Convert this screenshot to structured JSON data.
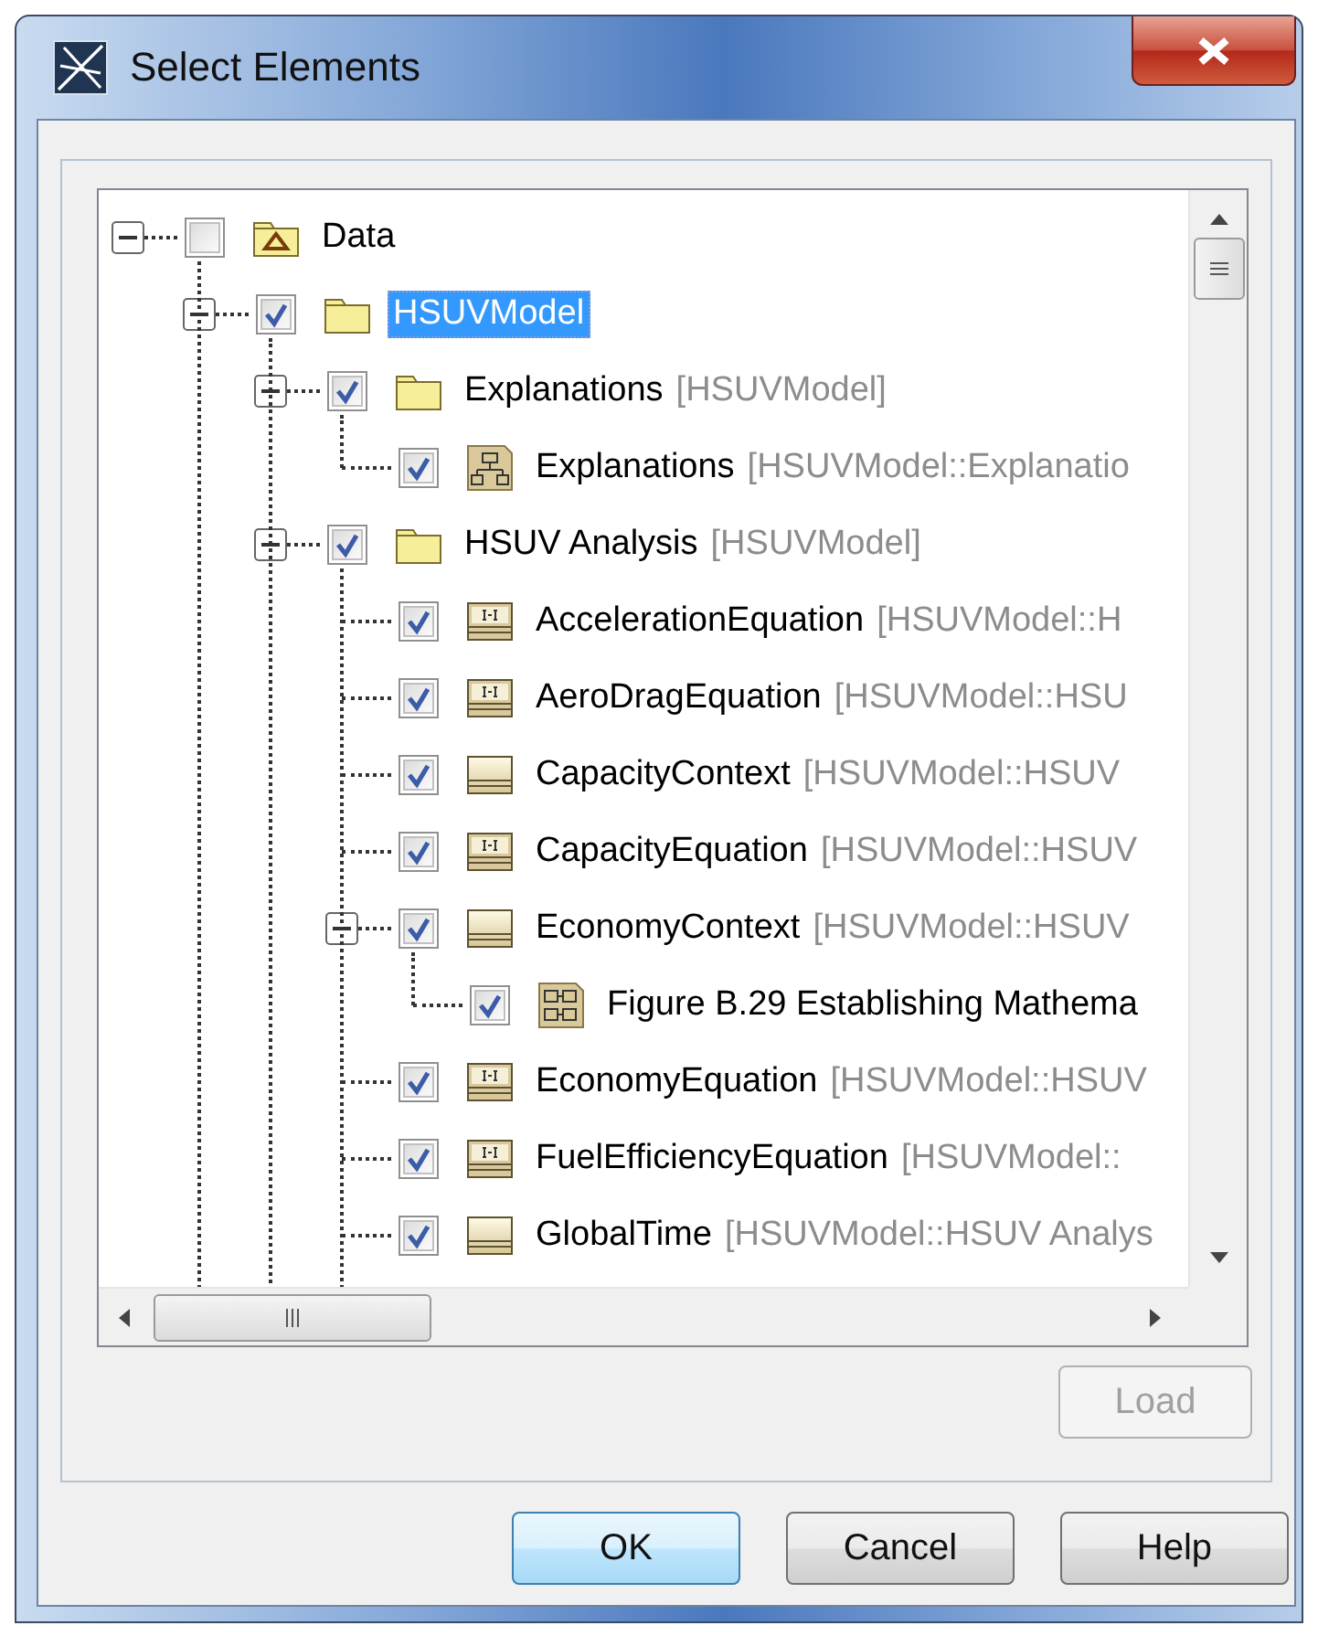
{
  "window": {
    "title": "Select Elements"
  },
  "tree": [
    {
      "kind": "model",
      "name": "Data",
      "checked": false,
      "selected": false,
      "expanded": true,
      "children": [
        {
          "kind": "package",
          "name": "HSUVModel",
          "checked": true,
          "selected": true,
          "expanded": true,
          "children": [
            {
              "kind": "package",
              "name": "Explanations",
              "detail": "[HSUVModel]",
              "checked": true,
              "selected": false,
              "expanded": true,
              "children": [
                {
                  "kind": "class-diagram",
                  "name": "Explanations",
                  "detail": "[HSUVModel::Explanatio",
                  "checked": true,
                  "selected": false
                }
              ]
            },
            {
              "kind": "package",
              "name": "HSUV Analysis",
              "detail": "[HSUVModel]",
              "checked": true,
              "selected": false,
              "expanded": true,
              "children": [
                {
                  "kind": "constraint-block",
                  "name": "AccelerationEquation",
                  "detail": "[HSUVModel::H",
                  "checked": true,
                  "selected": false
                },
                {
                  "kind": "constraint-block",
                  "name": "AeroDragEquation",
                  "detail": "[HSUVModel::HSU",
                  "checked": true,
                  "selected": false
                },
                {
                  "kind": "block",
                  "name": "CapacityContext",
                  "detail": "[HSUVModel::HSUV",
                  "checked": true,
                  "selected": false
                },
                {
                  "kind": "constraint-block",
                  "name": "CapacityEquation",
                  "detail": "[HSUVModel::HSUV",
                  "checked": true,
                  "selected": false
                },
                {
                  "kind": "block",
                  "name": "EconomyContext",
                  "detail": "[HSUVModel::HSUV",
                  "checked": true,
                  "selected": false,
                  "expanded": true,
                  "children": [
                    {
                      "kind": "parametric-diagram",
                      "name": "Figure B.29 Establishing Mathema",
                      "checked": true,
                      "selected": false
                    }
                  ]
                },
                {
                  "kind": "constraint-block",
                  "name": "EconomyEquation",
                  "detail": "[HSUVModel::HSUV",
                  "checked": true,
                  "selected": false
                },
                {
                  "kind": "constraint-block",
                  "name": "FuelEfficiencyEquation",
                  "detail": "[HSUVModel::",
                  "checked": true,
                  "selected": false
                },
                {
                  "kind": "block",
                  "name": "GlobalTime",
                  "detail": "[HSUVModel::HSUV Analys",
                  "checked": true,
                  "selected": false
                }
              ]
            }
          ]
        }
      ]
    }
  ],
  "load_button": {
    "label": "Load",
    "disabled": true
  },
  "buttons": [
    {
      "label": "OK",
      "default": true
    },
    {
      "label": "Cancel",
      "default": false
    },
    {
      "label": "Help",
      "default": false
    }
  ]
}
